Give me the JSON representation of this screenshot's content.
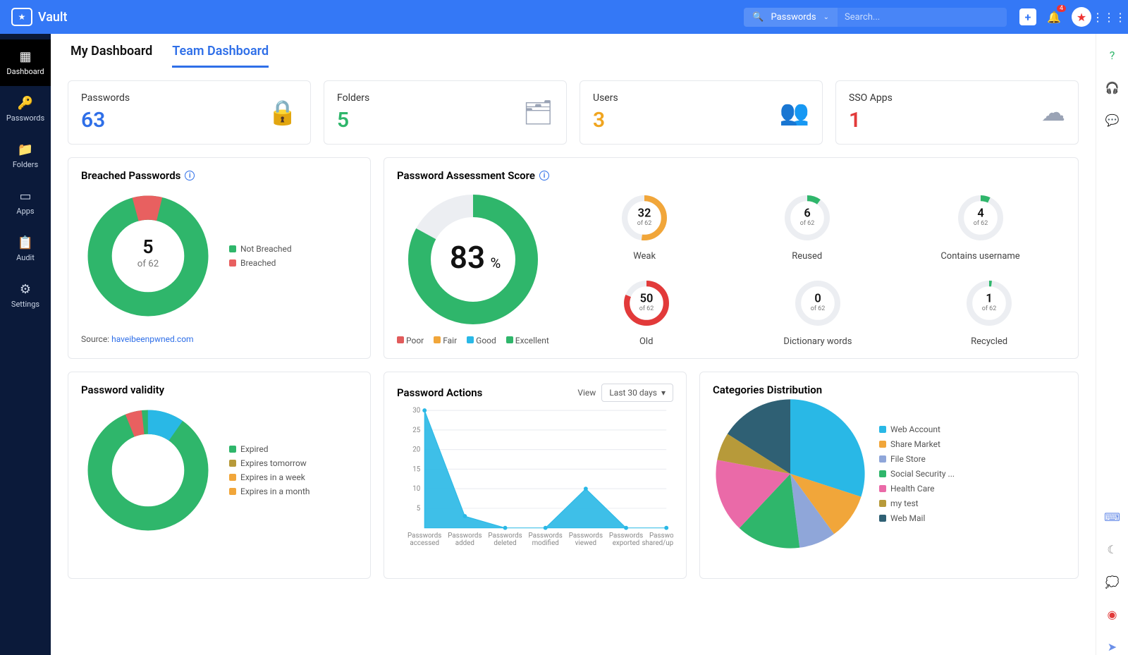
{
  "app": {
    "name": "Vault"
  },
  "topbar": {
    "dropdown_label": "Passwords",
    "search_placeholder": "Search...",
    "notification_count": "4"
  },
  "sidebar": {
    "items": [
      {
        "label": "Dashboard"
      },
      {
        "label": "Passwords"
      },
      {
        "label": "Folders"
      },
      {
        "label": "Apps"
      },
      {
        "label": "Audit"
      },
      {
        "label": "Settings"
      }
    ]
  },
  "tabs": {
    "my": "My Dashboard",
    "team": "Team Dashboard"
  },
  "stats": {
    "passwords": {
      "label": "Passwords",
      "value": "63",
      "color": "#2f6fe8"
    },
    "folders": {
      "label": "Folders",
      "value": "5",
      "color": "#2fb66b"
    },
    "users": {
      "label": "Users",
      "value": "3",
      "color": "#f0a51f"
    },
    "sso": {
      "label": "SSO Apps",
      "value": "1",
      "color": "#e23a3a"
    }
  },
  "breached": {
    "title": "Breached Passwords",
    "center_value": "5",
    "center_sub": "of 62",
    "legend": [
      {
        "label": "Not Breached",
        "color": "#2fb66b"
      },
      {
        "label": "Breached",
        "color": "#e86060"
      }
    ],
    "source_prefix": "Source: ",
    "source_link": "haveibeenpwned.com"
  },
  "assessment": {
    "title": "Password Assessment Score",
    "percent": "83",
    "percent_suffix": "%",
    "legend": [
      {
        "label": "Poor",
        "color": "#e15b5b"
      },
      {
        "label": "Fair",
        "color": "#f1a63a"
      },
      {
        "label": "Good",
        "color": "#29b8e6"
      },
      {
        "label": "Excellent",
        "color": "#2fb66b"
      }
    ],
    "minis": [
      {
        "value": "32",
        "sub": "of 62",
        "label": "Weak",
        "color": "#f1a63a",
        "pct": 52
      },
      {
        "value": "6",
        "sub": "of 62",
        "label": "Reused",
        "color": "#2fb66b",
        "pct": 10
      },
      {
        "value": "4",
        "sub": "of 62",
        "label": "Contains username",
        "color": "#2fb66b",
        "pct": 7
      },
      {
        "value": "50",
        "sub": "of 62",
        "label": "Old",
        "color": "#e23a3a",
        "pct": 81
      },
      {
        "value": "0",
        "sub": "of 62",
        "label": "Dictionary words",
        "color": "#2fb66b",
        "pct": 0
      },
      {
        "value": "1",
        "sub": "of 62",
        "label": "Recycled",
        "color": "#2fb66b",
        "pct": 2
      }
    ]
  },
  "validity": {
    "title": "Password validity",
    "legend": [
      {
        "label": "Expired",
        "color": "#2fb66b"
      },
      {
        "label": "Expires tomorrow",
        "color": "#b79a3a"
      },
      {
        "label": "Expires in a week",
        "color": "#f1a63a"
      },
      {
        "label": "Expires in a month",
        "color": "#f1a63a"
      }
    ]
  },
  "actions": {
    "title": "Password Actions",
    "view_label": "View",
    "view_value": "Last 30 days"
  },
  "categories": {
    "title": "Categories Distribution",
    "legend": [
      {
        "label": "Web Account",
        "color": "#29b8e6"
      },
      {
        "label": "Share Market",
        "color": "#f1a63a"
      },
      {
        "label": "File Store",
        "color": "#8fa6d9"
      },
      {
        "label": "Social Security ...",
        "color": "#2fb66b"
      },
      {
        "label": "Health Care",
        "color": "#ea6aa8"
      },
      {
        "label": "my test",
        "color": "#b79a3a"
      },
      {
        "label": "Web Mail",
        "color": "#2f6074"
      }
    ]
  },
  "chart_data": [
    {
      "type": "pie",
      "title": "Breached Passwords",
      "series": [
        {
          "name": "Not Breached",
          "value": 57
        },
        {
          "name": "Breached",
          "value": 5
        }
      ],
      "total": 62
    },
    {
      "type": "pie",
      "title": "Password Assessment Score",
      "value_percent": 83,
      "legend": [
        "Poor",
        "Fair",
        "Good",
        "Excellent"
      ]
    },
    {
      "type": "pie",
      "title": "Password validity",
      "series": [
        {
          "name": "Expired",
          "value": 52
        },
        {
          "name": "Expires tomorrow",
          "value": 2
        },
        {
          "name": "Expires in a week",
          "value": 5
        },
        {
          "name": "Expires in a month",
          "value": 3
        }
      ]
    },
    {
      "type": "area",
      "title": "Password Actions",
      "x": [
        "Passwords accessed",
        "Passwords added",
        "Passwords deleted",
        "Passwords modified",
        "Passwords viewed",
        "Passwords exported",
        "Passwords shared/updated"
      ],
      "y": [
        30,
        3,
        0,
        0,
        10,
        0,
        0
      ],
      "ylim": [
        0,
        30
      ],
      "y_ticks": [
        5,
        10,
        15,
        20,
        25,
        30
      ]
    },
    {
      "type": "pie",
      "title": "Categories Distribution",
      "series": [
        {
          "name": "Web Account",
          "value": 30
        },
        {
          "name": "Share Market",
          "value": 10
        },
        {
          "name": "File Store",
          "value": 8
        },
        {
          "name": "Social Security",
          "value": 14
        },
        {
          "name": "Health Care",
          "value": 16
        },
        {
          "name": "my test",
          "value": 6
        },
        {
          "name": "Web Mail",
          "value": 16
        }
      ]
    }
  ]
}
